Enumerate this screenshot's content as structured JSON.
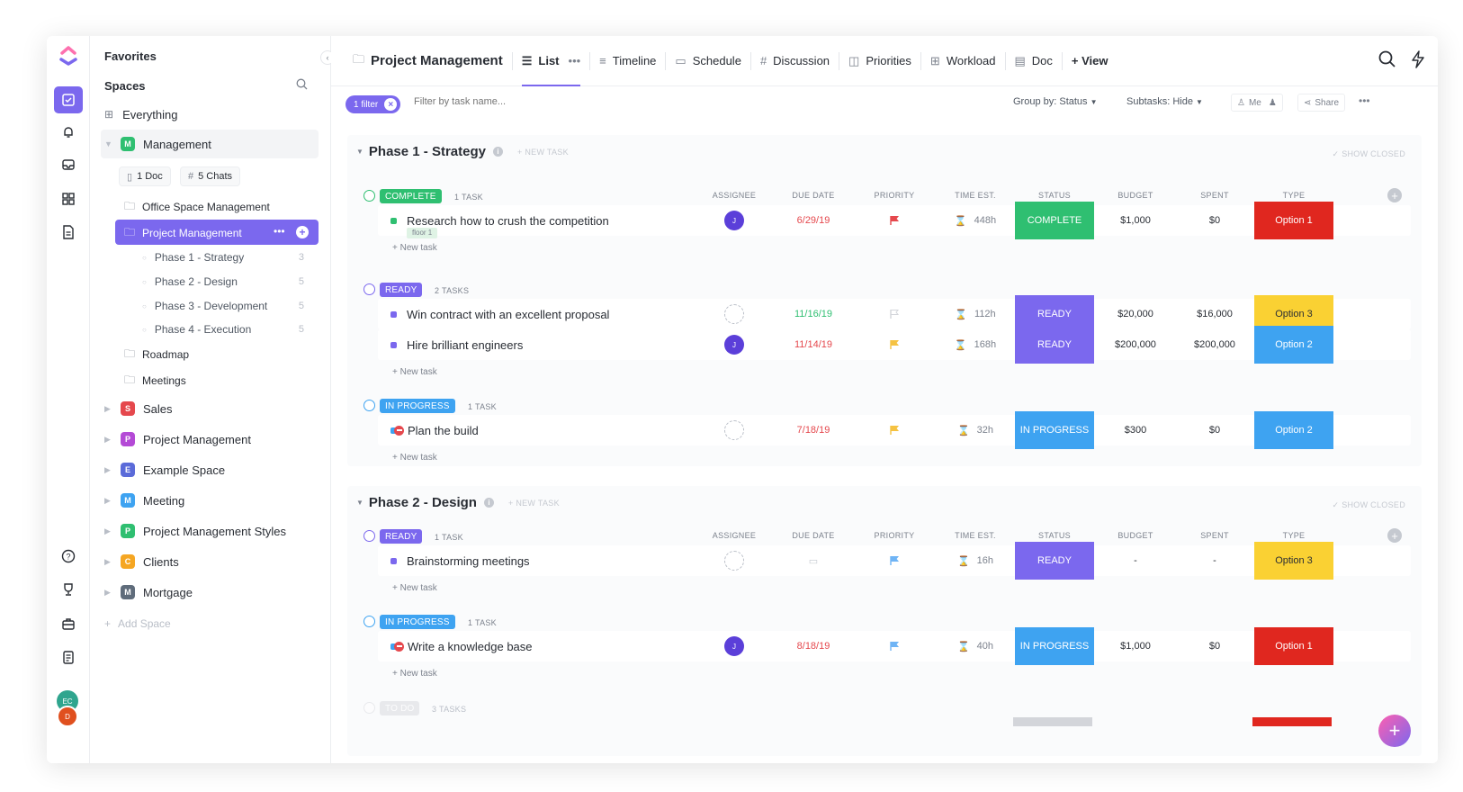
{
  "sidebar": {
    "favorites": "Favorites",
    "spaces": "Spaces",
    "everything": "Everything",
    "management": {
      "badge": "M",
      "label": "Management"
    },
    "doc_chip": "1 Doc",
    "chats_chip": "5 Chats",
    "folders": [
      "Office Space Management",
      "Project Management"
    ],
    "subitems": [
      {
        "label": "Phase 1 - Strategy",
        "count": "3"
      },
      {
        "label": "Phase 2 - Design",
        "count": "5"
      },
      {
        "label": "Phase 3 - Development",
        "count": "5"
      },
      {
        "label": "Phase 4 - Execution",
        "count": "5"
      }
    ],
    "roadmap": "Roadmap",
    "meetings": "Meetings",
    "spaces_list": [
      {
        "badge": "S",
        "label": "Sales",
        "color": "#e5484d"
      },
      {
        "badge": "P",
        "label": "Project Management",
        "color": "#b44ad6"
      },
      {
        "badge": "E",
        "label": "Example Space",
        "color": "#5b6bd9"
      },
      {
        "badge": "M",
        "label": "Meeting",
        "color": "#3ea3f1"
      },
      {
        "badge": "P",
        "label": "Project Management Styles",
        "color": "#2fbf71"
      },
      {
        "badge": "C",
        "label": "Clients",
        "color": "#f5a623"
      },
      {
        "badge": "M",
        "label": "Mortgage",
        "color": "#5f6c7b"
      }
    ],
    "add_space": "Add Space"
  },
  "rail": {
    "avatar1": "EC",
    "avatar2": "D"
  },
  "header": {
    "title": "Project Management",
    "tabs": [
      "List",
      "Timeline",
      "Schedule",
      "Discussion",
      "Priorities",
      "Workload",
      "Doc"
    ],
    "add_view": "+ View"
  },
  "filterbar": {
    "filter_chip": "1 filter",
    "placeholder": "Filter by task name...",
    "group_by": "Group by: Status",
    "subtasks": "Subtasks: Hide",
    "me": "Me",
    "share": "Share"
  },
  "columns": [
    "ASSIGNEE",
    "DUE DATE",
    "PRIORITY",
    "TIME EST.",
    "STATUS",
    "BUDGET",
    "SPENT",
    "TYPE"
  ],
  "phases": [
    {
      "title": "Phase 1 - Strategy",
      "new_task": "+ NEW TASK",
      "show_closed": "✓ SHOW CLOSED",
      "groups": [
        {
          "status": "COMPLETE",
          "count": "1 TASK",
          "color": "#2fbf71",
          "tasks": [
            {
              "name": "Research how to crush the competition",
              "tag": "floor 1",
              "assignee": "J",
              "due": "6/29/19",
              "due_color": "#e5484d",
              "priority": "#e5484d",
              "time": "448h",
              "status": "COMPLETE",
              "budget": "$1,000",
              "spent": "$0",
              "type": "Option 1",
              "type_bg": "#e0271f",
              "type_fg": "#fff"
            }
          ]
        },
        {
          "status": "READY",
          "count": "2 TASKS",
          "color": "#7b68ee",
          "tasks": [
            {
              "name": "Win contract with an excellent proposal",
              "assignee": "",
              "due": "11/16/19",
              "due_color": "#2fbf71",
              "priority": "",
              "time": "112h",
              "status": "READY",
              "budget": "$20,000",
              "spent": "$16,000",
              "type": "Option 3",
              "type_bg": "#fad133",
              "type_fg": "#292d34"
            },
            {
              "name": "Hire brilliant engineers",
              "assignee": "J",
              "due": "11/14/19",
              "due_color": "#e5484d",
              "priority": "#f5c242",
              "time": "168h",
              "status": "READY",
              "budget": "$200,000",
              "spent": "$200,000",
              "type": "Option 2",
              "type_bg": "#3ea3f1",
              "type_fg": "#fff"
            }
          ]
        },
        {
          "status": "IN PROGRESS",
          "count": "1 TASK",
          "color": "#3ea3f1",
          "tasks": [
            {
              "name": "Plan the build",
              "assignee": "",
              "due": "7/18/19",
              "due_color": "#e5484d",
              "priority": "#f5c242",
              "time": "32h",
              "status": "IN PROGRESS",
              "budget": "$300",
              "spent": "$0",
              "type": "Option 2",
              "type_bg": "#3ea3f1",
              "type_fg": "#fff"
            }
          ]
        }
      ]
    },
    {
      "title": "Phase 2 - Design",
      "new_task": "+ NEW TASK",
      "show_closed": "✓ SHOW CLOSED",
      "groups": [
        {
          "status": "READY",
          "count": "1 TASK",
          "color": "#7b68ee",
          "tasks": [
            {
              "name": "Brainstorming meetings",
              "assignee": "",
              "due": "",
              "due_color": "#b9bec7",
              "priority": "#6fb4f5",
              "time": "16h",
              "status": "READY",
              "budget": "-",
              "spent": "-",
              "type": "Option 3",
              "type_bg": "#fad133",
              "type_fg": "#292d34"
            }
          ]
        },
        {
          "status": "IN PROGRESS",
          "count": "1 TASK",
          "color": "#3ea3f1",
          "tasks": [
            {
              "name": "Write a knowledge base",
              "assignee": "J",
              "due": "8/18/19",
              "due_color": "#e5484d",
              "priority": "#6fb4f5",
              "time": "40h",
              "status": "IN PROGRESS",
              "budget": "$1,000",
              "spent": "$0",
              "type": "Option 1",
              "type_bg": "#e0271f",
              "type_fg": "#fff"
            }
          ]
        },
        {
          "status": "TO DO",
          "count": "3 TASKS",
          "color": "#d3d5da",
          "tasks": []
        }
      ]
    }
  ],
  "new_task_label": "+ New task",
  "status_colors": {
    "COMPLETE": "#2fbf71",
    "READY": "#7b68ee",
    "IN PROGRESS": "#3ea3f1"
  }
}
